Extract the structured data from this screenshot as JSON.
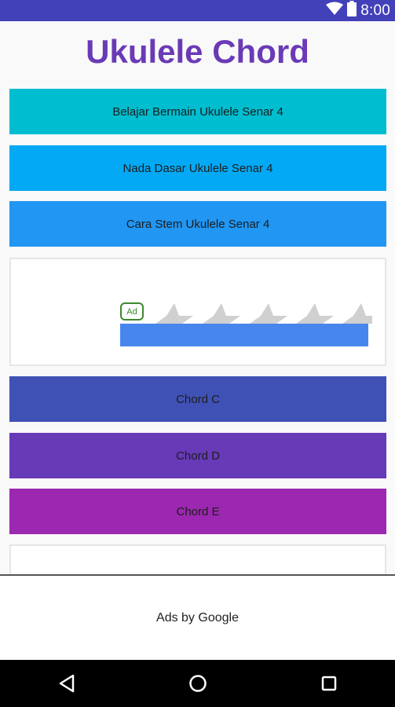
{
  "status_bar": {
    "time": "8:00",
    "icons": [
      "wifi-icon",
      "battery-icon"
    ],
    "color": "#4341b9"
  },
  "app": {
    "title": "Ukulele Chord",
    "title_color": "#6a3ab6"
  },
  "menu_buttons": [
    {
      "label": "Belajar Bermain Ukulele Senar 4",
      "color": "#00bdd0"
    },
    {
      "label": "Nada Dasar Ukulele Senar 4",
      "color": "#03a9f4"
    },
    {
      "label": "Cara Stem Ukulele Senar 4",
      "color": "#2196f3"
    }
  ],
  "ad_card": {
    "badge": "Ad",
    "rating_icons": [
      "star-icon",
      "star-icon",
      "star-icon",
      "star-icon",
      "star-icon"
    ]
  },
  "chord_buttons": [
    {
      "label": "Chord C",
      "color": "#3f51b5"
    },
    {
      "label": "Chord D",
      "color": "#673ab7"
    },
    {
      "label": "Chord E",
      "color": "#9c27b0"
    }
  ],
  "footer": {
    "ads_label": "Ads by Google"
  },
  "nav_bar": {
    "buttons": [
      "back-icon",
      "home-icon",
      "recents-icon"
    ]
  }
}
